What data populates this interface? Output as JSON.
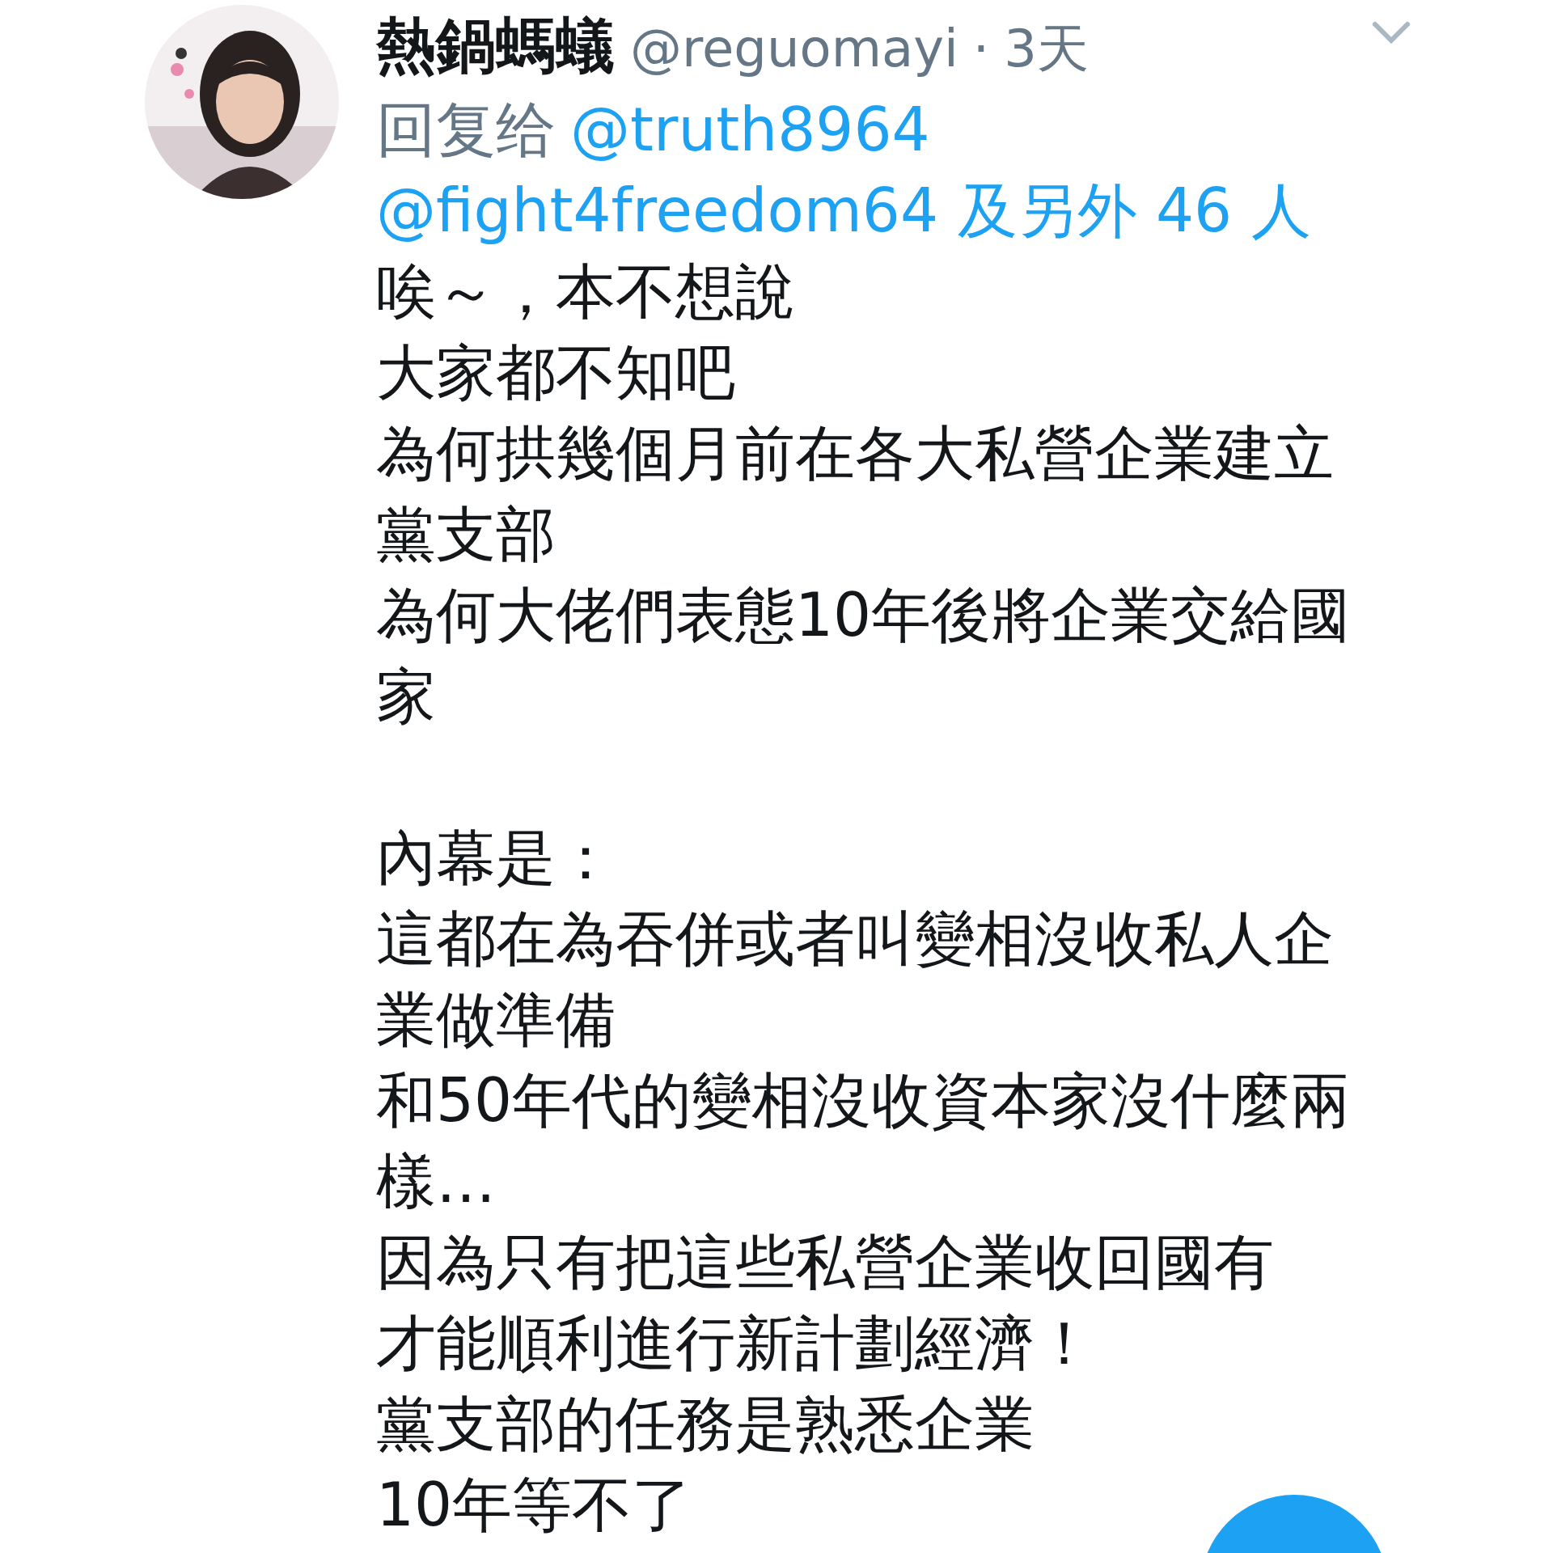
{
  "tweet": {
    "name": "熱鍋螞蟻",
    "handle": "@reguomayi",
    "separator": "·",
    "time": "3天",
    "reply_prefix": "回复给",
    "reply_to": [
      "@truth8964",
      "@fight4freedom64 及另外 46 人"
    ],
    "paragraphs": [
      [
        "唉～，本不想說",
        "大家都不知吧",
        "為何拱幾個月前在各大私營企業建立",
        "黨支部",
        "為何大佬們表態10年後將企業交給國",
        "家"
      ],
      [
        "內幕是：",
        "這都在為吞併或者叫變相沒收私人企",
        "業做準備",
        "和50年代的變相沒收資本家沒什麼兩",
        "樣…",
        "因為只有把這些私營企業收回國有",
        "才能順利進行新計劃經濟！",
        "黨支部的任務是熟悉企業",
        "10年等不了"
      ]
    ]
  }
}
